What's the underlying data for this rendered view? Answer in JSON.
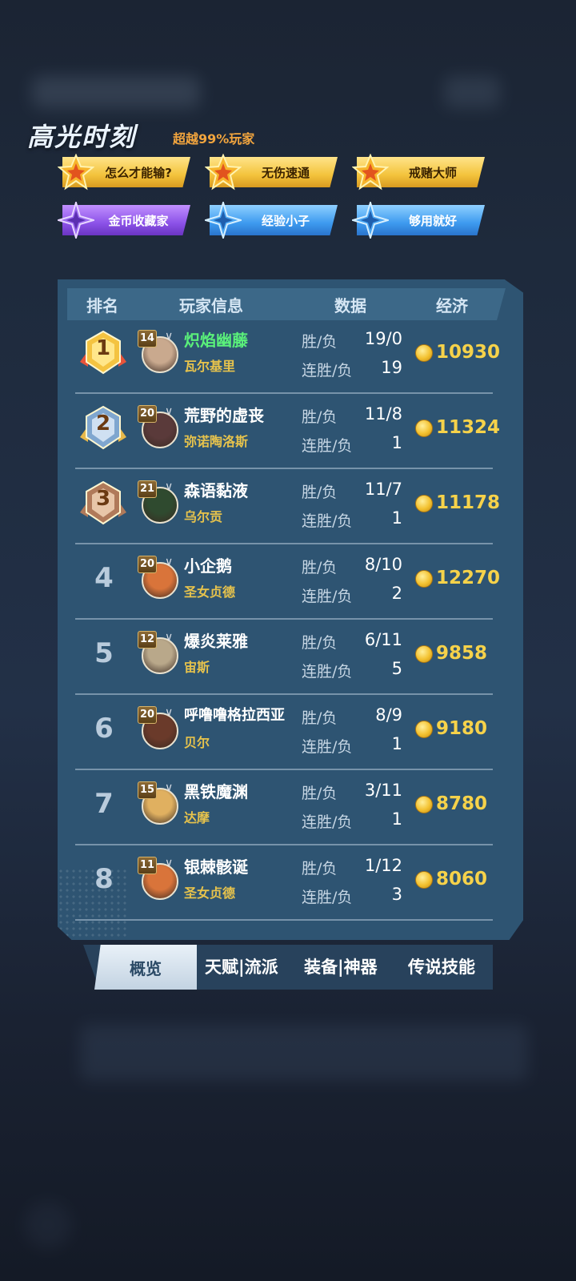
{
  "highlights": {
    "title": "高光时刻",
    "subtitle": "超越99%玩家",
    "badges": [
      {
        "label": "怎么才能输?",
        "style": "gold"
      },
      {
        "label": "无伤速通",
        "style": "gold"
      },
      {
        "label": "戒赌大师",
        "style": "gold"
      },
      {
        "label": "金币收藏家",
        "style": "purple"
      },
      {
        "label": "经验小子",
        "style": "blue"
      },
      {
        "label": "够用就好",
        "style": "blue"
      }
    ]
  },
  "table": {
    "headers": {
      "rank": "排名",
      "player": "玩家信息",
      "data": "数据",
      "economy": "经济"
    },
    "win_loss_label": "胜/负",
    "streak_label": "连胜/负",
    "rows": [
      {
        "rank": "1",
        "level": "14",
        "name": "炽焰幽藤",
        "hero": "瓦尔基里",
        "win_loss": "19/0",
        "streak": "19",
        "gold": "10930",
        "highlight": true
      },
      {
        "rank": "2",
        "level": "20",
        "name": "荒野的虚丧",
        "hero": "弥诺陶洛斯",
        "win_loss": "11/8",
        "streak": "1",
        "gold": "11324"
      },
      {
        "rank": "3",
        "level": "21",
        "name": "森语黏液",
        "hero": "乌尔贡",
        "win_loss": "11/7",
        "streak": "1",
        "gold": "11178"
      },
      {
        "rank": "4",
        "level": "20",
        "name": "小企鹅",
        "hero": "圣女贞德",
        "win_loss": "8/10",
        "streak": "2",
        "gold": "12270"
      },
      {
        "rank": "5",
        "level": "12",
        "name": "爆炎莱雅",
        "hero": "宙斯",
        "win_loss": "6/11",
        "streak": "5",
        "gold": "9858"
      },
      {
        "rank": "6",
        "level": "20",
        "name": "呼噜噜格拉西亚",
        "hero": "贝尔",
        "win_loss": "8/9",
        "streak": "1",
        "gold": "9180"
      },
      {
        "rank": "7",
        "level": "15",
        "name": "黑铁魔渊",
        "hero": "达摩",
        "win_loss": "3/11",
        "streak": "1",
        "gold": "8780"
      },
      {
        "rank": "8",
        "level": "11",
        "name": "银棘骸诞",
        "hero": "圣女贞德",
        "win_loss": "1/12",
        "streak": "3",
        "gold": "8060"
      }
    ]
  },
  "tabs": {
    "active": "概览",
    "items": [
      "天赋|流派",
      "装备|神器",
      "传说技能"
    ]
  },
  "colors": {
    "panel": "#2e5472",
    "gold_text": "#f6d24a",
    "highlight_name": "#5af07a",
    "hero_text": "#e7c34c"
  }
}
